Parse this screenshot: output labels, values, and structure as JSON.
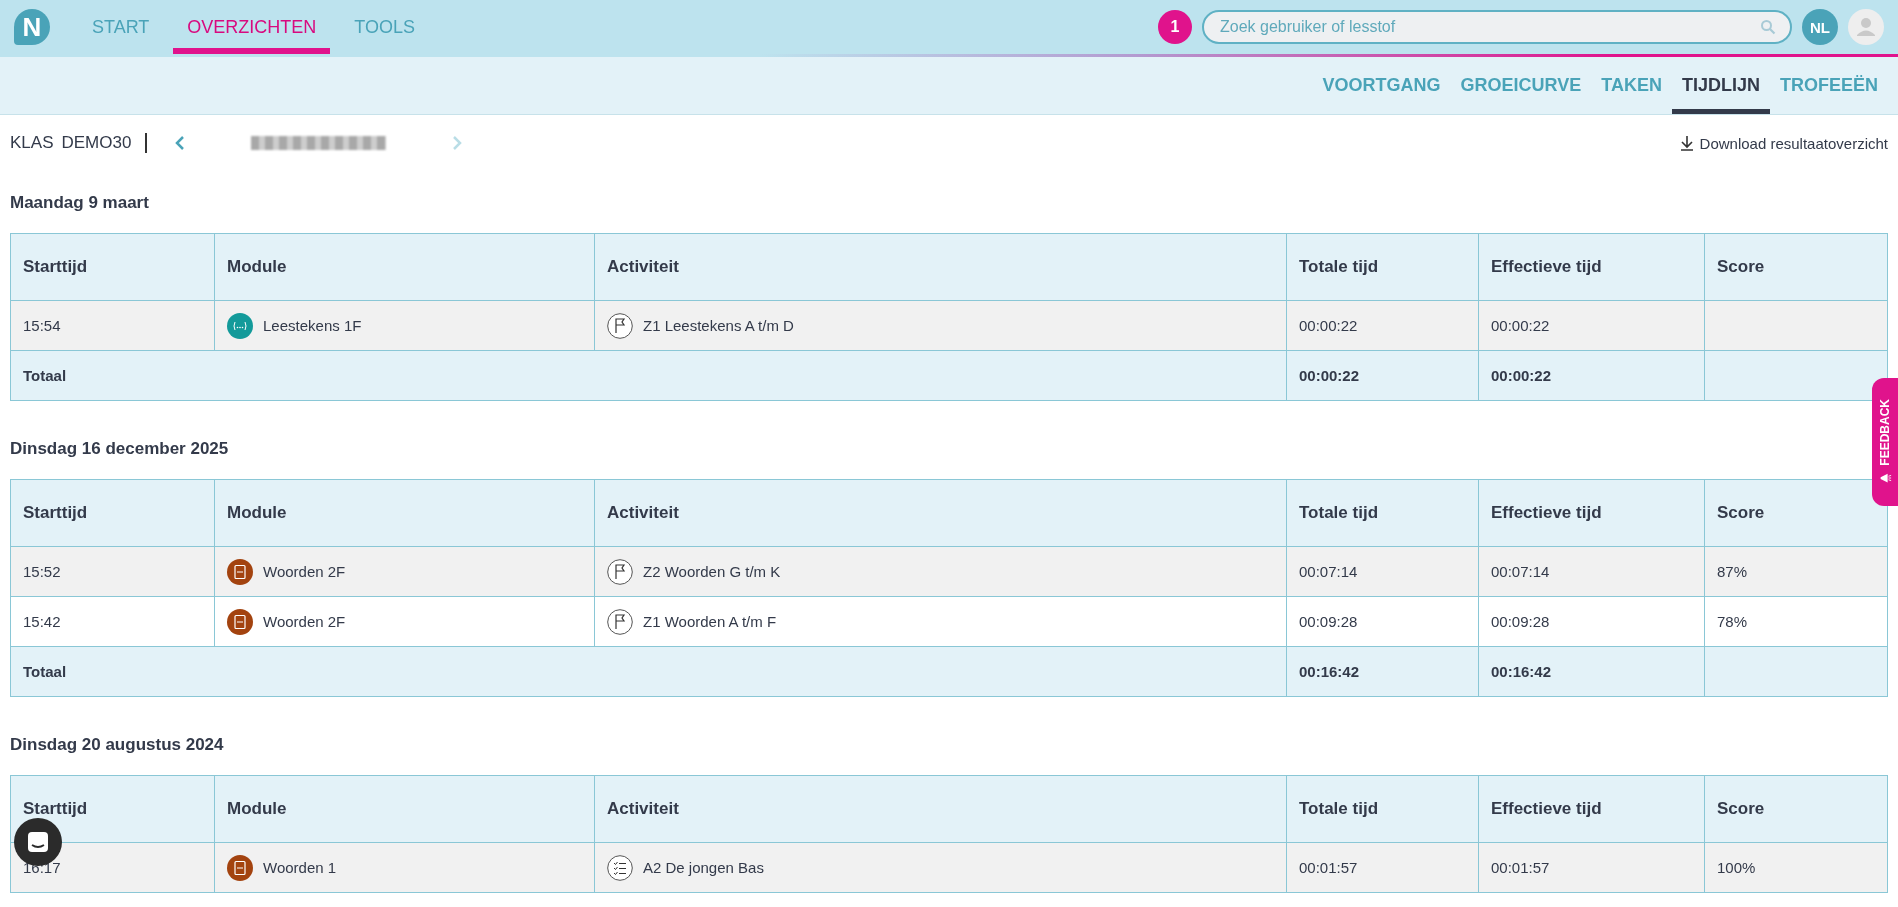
{
  "nav": {
    "items": [
      {
        "label": "START",
        "selected": false
      },
      {
        "label": "OVERZICHTEN",
        "selected": true
      },
      {
        "label": "TOOLS",
        "selected": false
      }
    ],
    "logo": "N",
    "notification_count": "1",
    "search": {
      "placeholder": "Zoek gebruiker of lesstof"
    },
    "language": "NL"
  },
  "subnav": [
    {
      "label": "VOORTGANG",
      "selected": false
    },
    {
      "label": "GROEICURVE",
      "selected": false
    },
    {
      "label": "TAKEN",
      "selected": false
    },
    {
      "label": "TIJDLIJN",
      "selected": true
    },
    {
      "label": "TROFEEËN",
      "selected": false
    }
  ],
  "class_bar": {
    "class_label": "KLAS",
    "class_name": "DEMO30",
    "download": "Download resultaatoverzicht"
  },
  "days": [
    {
      "date": "Maandag 9 maart",
      "columns": [
        "Starttijd",
        "Module",
        "Activiteit",
        "Totale tijd",
        "Effectieve tijd",
        "Score"
      ],
      "rows": [
        {
          "start": "15:54",
          "module": {
            "kind": "punctuation",
            "name": "Leestekens 1F"
          },
          "activity": {
            "kind": "flag",
            "name": "Z1 Leestekens A t/m D"
          },
          "total": "00:00:22",
          "effective": "00:00:22"
        }
      ],
      "total": {
        "label": "Totaal",
        "total": "00:00:22",
        "effective": "00:00:22"
      }
    },
    {
      "date": "Dinsdag 16 december 2025",
      "columns": [
        "Starttijd",
        "Module",
        "Activiteit",
        "Totale tijd",
        "Effectieve tijd",
        "Score"
      ],
      "rows": [
        {
          "start": "15:52",
          "module": {
            "kind": "book",
            "name": "Woorden 2F"
          },
          "activity": {
            "kind": "flag",
            "name": "Z2 Woorden G t/m K"
          },
          "total": "00:07:14",
          "effective": "00:07:14",
          "score": "87%"
        },
        {
          "start": "15:42",
          "module": {
            "kind": "book",
            "name": "Woorden 2F"
          },
          "activity": {
            "kind": "flag",
            "name": "Z1 Woorden A t/m F"
          },
          "total": "00:09:28",
          "effective": "00:09:28",
          "score": "78%"
        }
      ],
      "total": {
        "label": "Totaal",
        "total": "00:16:42",
        "effective": "00:16:42"
      }
    },
    {
      "date": "Dinsdag 20 augustus 2024",
      "columns": [
        "Starttijd",
        "Module",
        "Activiteit",
        "Totale tijd",
        "Effectieve tijd",
        "Score"
      ],
      "rows": [
        {
          "start": "16:17",
          "module": {
            "kind": "book",
            "name": "Woorden 1"
          },
          "activity": {
            "kind": "checklist",
            "name": "A2 De jongen Bas"
          },
          "total": "00:01:57",
          "effective": "00:01:57",
          "score": "100%"
        }
      ]
    }
  ],
  "feedback": "FEEDBACK"
}
